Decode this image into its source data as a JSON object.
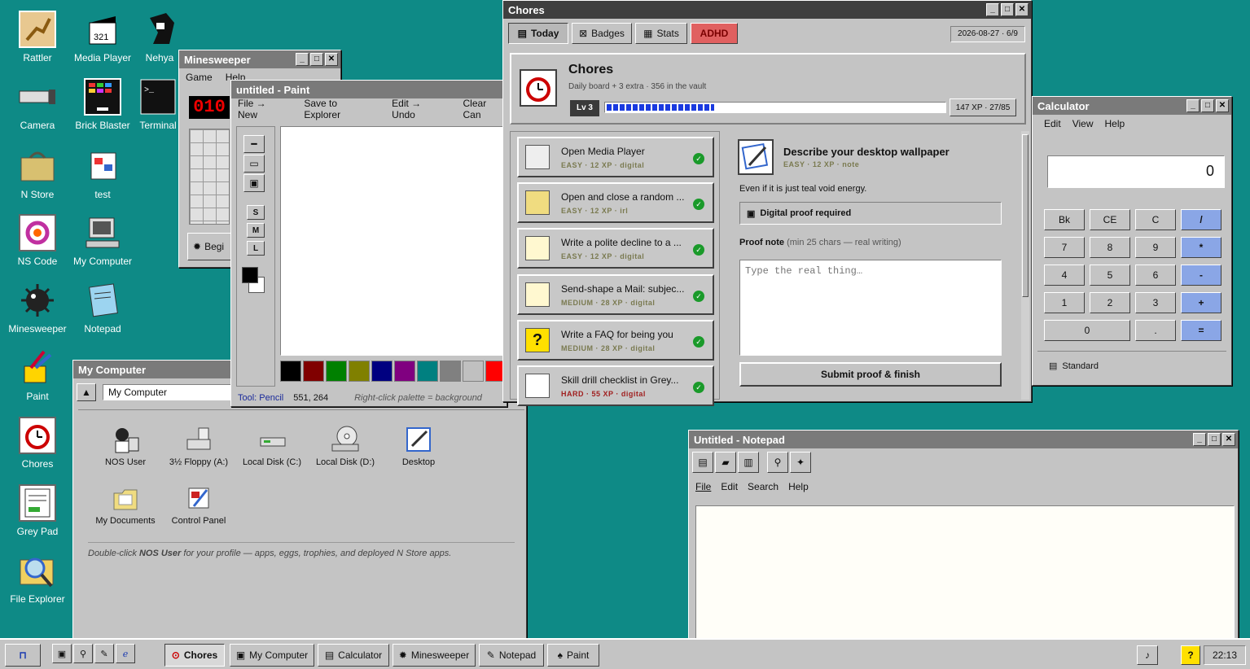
{
  "desktop": {
    "icons": [
      "Rattler",
      "Media Player",
      "Nehya",
      "Camera",
      "Brick Blaster",
      "Terminal",
      "N Store",
      "test",
      "NS Code",
      "My Computer",
      "Minesweeper",
      "Notepad",
      "Paint",
      "Chores",
      "Grey Pad",
      "File Explorer"
    ]
  },
  "minesweeper": {
    "title": "Minesweeper",
    "menu": [
      "Game",
      "Help"
    ],
    "counter": "010",
    "begin": "Begi"
  },
  "paint": {
    "title": "untitled - Paint",
    "menu": [
      "File → New",
      "Save to Explorer",
      "Edit → Undo",
      "Clear Can"
    ],
    "sizes": [
      "S",
      "M",
      "L"
    ],
    "tool": "Tool: Pencil",
    "coords": "551, 264",
    "hint": "Right-click palette = background",
    "palette": [
      "#000000",
      "#800000",
      "#008000",
      "#808000",
      "#000080",
      "#800080",
      "#008080",
      "#808080",
      "#c0c0c0",
      "#ff0000",
      "#00ff00"
    ]
  },
  "mycomputer": {
    "title": "My Computer",
    "address": "My Computer",
    "items": [
      "NOS User",
      "3½ Floppy (A:)",
      "Local Disk (C:)",
      "Local Disk (D:)",
      "Desktop",
      "My Documents",
      "Control Panel"
    ],
    "footer_pre": "Double-click ",
    "footer_bold": "NOS User",
    "footer_post": " for your profile — apps, eggs, trophies, and deployed N Store apps."
  },
  "chores": {
    "title": "Chores",
    "tabs": [
      "Today",
      "Badges",
      "Stats",
      "ADHD"
    ],
    "date": "2026-08-27 · 6/9",
    "heading": "Chores",
    "sub": "Daily board + 3 extra · 356 in the vault",
    "level": "Lv 3",
    "xp": "147 XP · 27/85",
    "xp_progress": 0.32,
    "list": [
      {
        "t": "Open Media Player",
        "m": "EASY · 12 XP · digital"
      },
      {
        "t": "Open and close a random ...",
        "m": "EASY · 12 XP · irl"
      },
      {
        "t": "Write a polite decline to a ...",
        "m": "EASY · 12 XP · digital"
      },
      {
        "t": "Send-shape a Mail: subjec...",
        "m": "MEDIUM · 28 XP · digital"
      },
      {
        "t": "Write a FAQ for being you",
        "m": "MEDIUM · 28 XP · digital"
      },
      {
        "t": "Skill drill checklist in Grey...",
        "m": "HARD · 55 XP · digital"
      }
    ],
    "detail": {
      "title": "Describe your desktop wallpaper",
      "meta": "EASY · 12 XP · note",
      "desc": "Even if it is just teal void energy.",
      "proof": "Digital proof required",
      "note_label": "Proof note",
      "note_hint": "(min 25 chars — real writing)",
      "placeholder": "Type the real thing…",
      "submit": "Submit proof & finish"
    }
  },
  "calculator": {
    "title": "Calculator",
    "menu": [
      "Edit",
      "View",
      "Help"
    ],
    "display": "0",
    "keys": [
      "Bk",
      "CE",
      "C",
      "/",
      "7",
      "8",
      "9",
      "*",
      "4",
      "5",
      "6",
      "-",
      "1",
      "2",
      "3",
      "+",
      "0",
      ".",
      "="
    ],
    "mode": "Standard"
  },
  "notepad": {
    "title": "Untitled - Notepad",
    "menu": [
      "File",
      "Edit",
      "Search",
      "Help"
    ]
  },
  "taskbar": {
    "items": [
      "Chores",
      "My Computer",
      "Calculator",
      "Minesweeper",
      "Notepad",
      "Paint"
    ],
    "clock": "22:13"
  }
}
